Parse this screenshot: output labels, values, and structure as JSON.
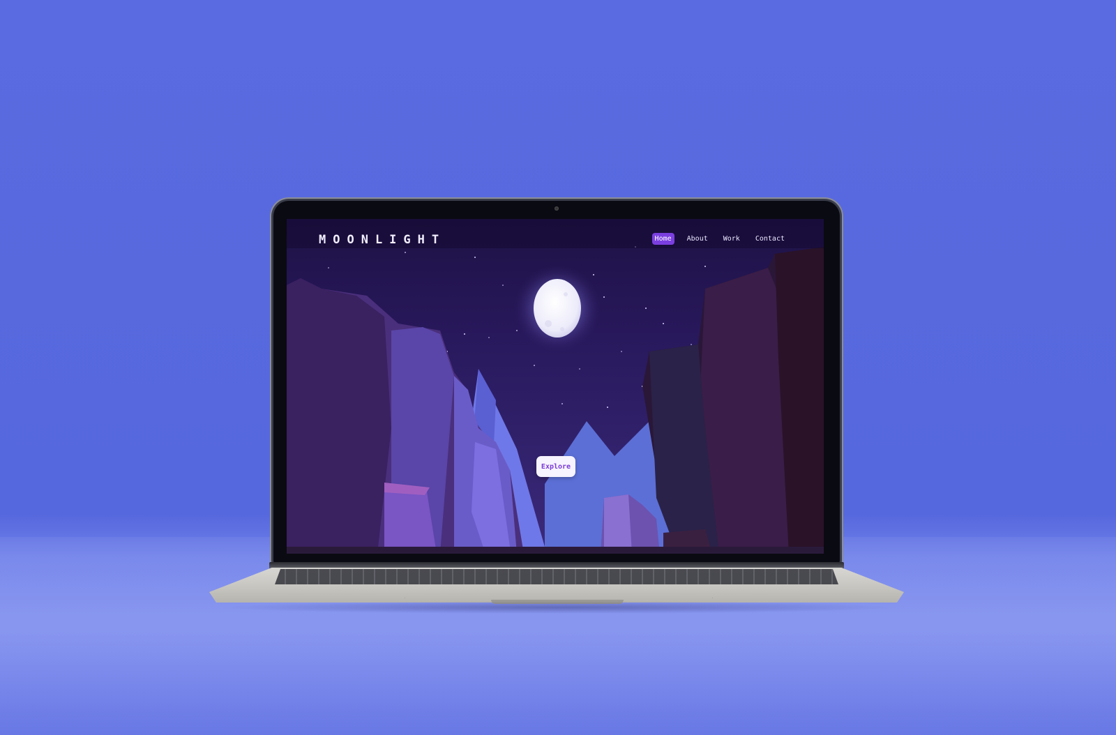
{
  "page": {
    "background_color": "#5a6ae0"
  },
  "website": {
    "brand": "MOONLIGHT",
    "nav": [
      {
        "label": "Home",
        "active": true
      },
      {
        "label": "About",
        "active": false
      },
      {
        "label": "Work",
        "active": false
      },
      {
        "label": "Contact",
        "active": false
      }
    ],
    "cta_label": "Explore",
    "colors": {
      "nav_active": "#7b3fe0",
      "cta_text": "#7a3bd6",
      "sky": "#28185c",
      "moon": "#f4f2ff"
    }
  }
}
